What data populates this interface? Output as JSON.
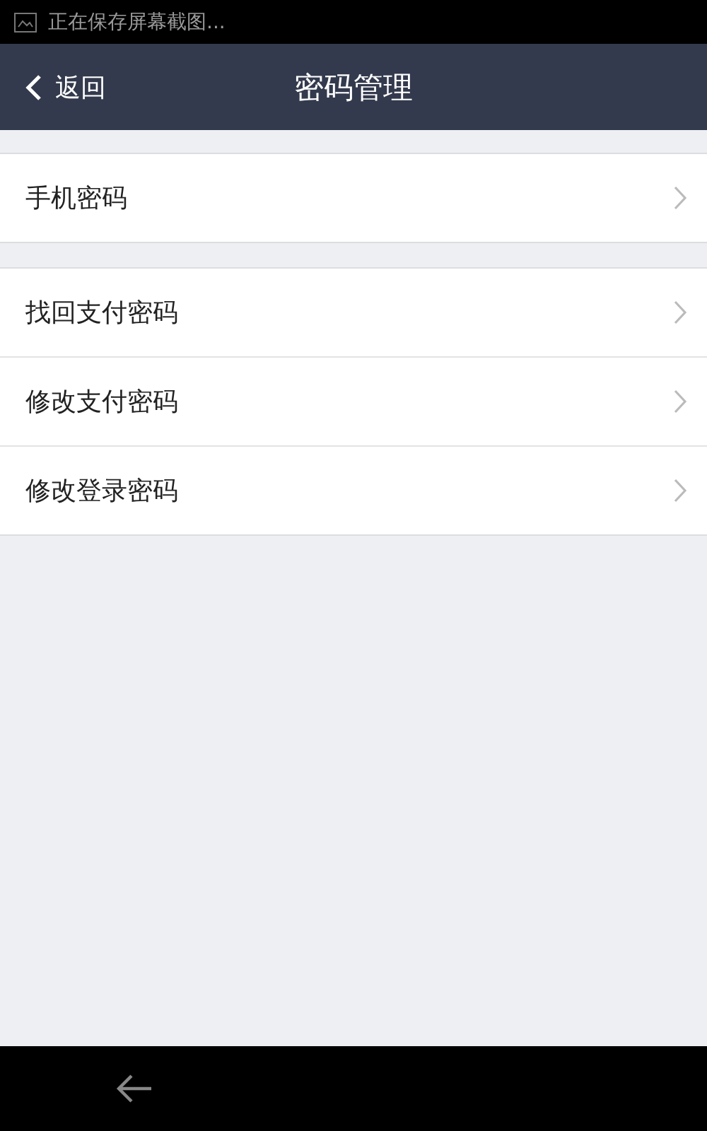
{
  "status_bar": {
    "notification": "正在保存屏幕截图..."
  },
  "nav_bar": {
    "back_label": "返回",
    "title": "密码管理"
  },
  "groups": [
    {
      "items": [
        {
          "label": "手机密码"
        }
      ]
    },
    {
      "items": [
        {
          "label": "找回支付密码"
        },
        {
          "label": "修改支付密码"
        },
        {
          "label": "修改登录密码"
        }
      ]
    }
  ]
}
